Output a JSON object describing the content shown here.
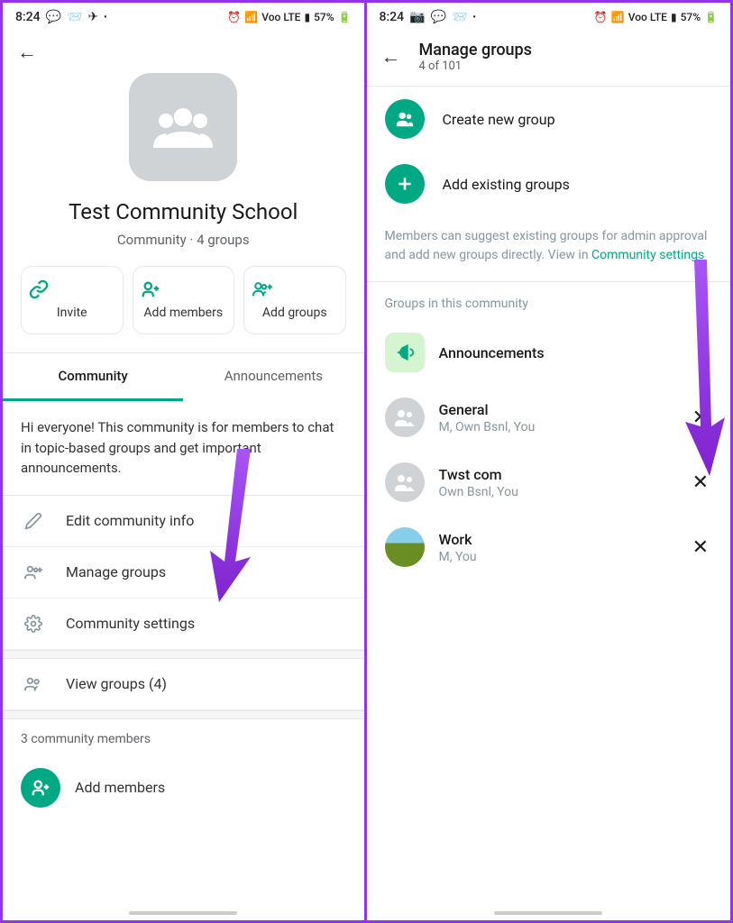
{
  "status": {
    "time": "8:24",
    "battery": "57%",
    "network": "Voo LTE"
  },
  "left": {
    "title": "Test Community School",
    "subtitle": "Community · 4 groups",
    "actions": {
      "invite": "Invite",
      "add_members": "Add members",
      "add_groups": "Add groups"
    },
    "tabs": {
      "community": "Community",
      "announcements": "Announcements"
    },
    "description": "Hi everyone! This community is for members to chat in topic-based groups and get important announcements.",
    "menu": {
      "edit": "Edit community info",
      "manage": "Manage groups",
      "settings": "Community settings",
      "view": "View groups (4)"
    },
    "members_section": "3 community members",
    "add_members_label": "Add members"
  },
  "right": {
    "header": {
      "title": "Manage groups",
      "subtitle": "4 of 101"
    },
    "create": "Create new group",
    "add_existing": "Add existing groups",
    "info_text": "Members can suggest existing groups for admin approval and add new groups directly. View in ",
    "info_link": "Community settings",
    "section_header": "Groups in this community",
    "groups": [
      {
        "name": "Announcements",
        "members": ""
      },
      {
        "name": "General",
        "members": "M, Own Bsnl, You"
      },
      {
        "name": "Twst com",
        "members": "Own Bsnl, You"
      },
      {
        "name": "Work",
        "members": "M, You"
      }
    ]
  }
}
